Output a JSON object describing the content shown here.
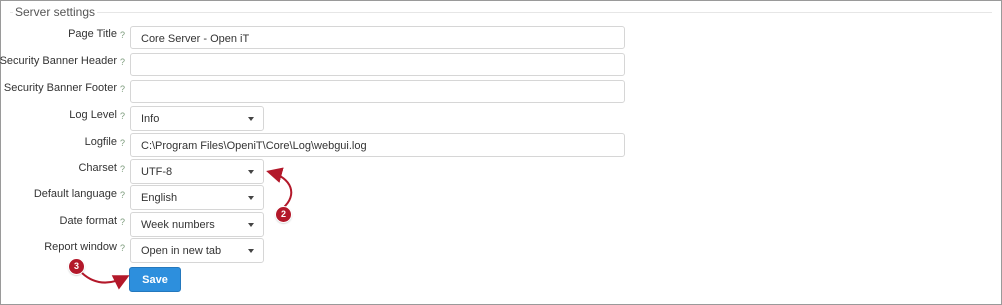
{
  "section": {
    "title": "Server settings",
    "help_glyph": "?"
  },
  "fields": {
    "page_title": {
      "label": "Page Title",
      "value": "Core Server - Open iT"
    },
    "security_banner_header": {
      "label": "Security Banner Header",
      "value": ""
    },
    "security_banner_footer": {
      "label": "Security Banner Footer",
      "value": ""
    },
    "log_level": {
      "label": "Log Level",
      "value": "Info"
    },
    "logfile": {
      "label": "Logfile",
      "value": "C:\\Program Files\\OpeniT\\Core\\Log\\webgui.log"
    },
    "charset": {
      "label": "Charset",
      "value": "UTF-8"
    },
    "default_language": {
      "label": "Default language",
      "value": "English"
    },
    "date_format": {
      "label": "Date format",
      "value": "Week numbers"
    },
    "report_window": {
      "label": "Report window",
      "value": "Open in new tab"
    }
  },
  "actions": {
    "save_label": "Save"
  },
  "callouts": {
    "charset": "2",
    "save": "3"
  },
  "colors": {
    "save_button": "#2d8fdd",
    "callout": "#b3182a"
  }
}
